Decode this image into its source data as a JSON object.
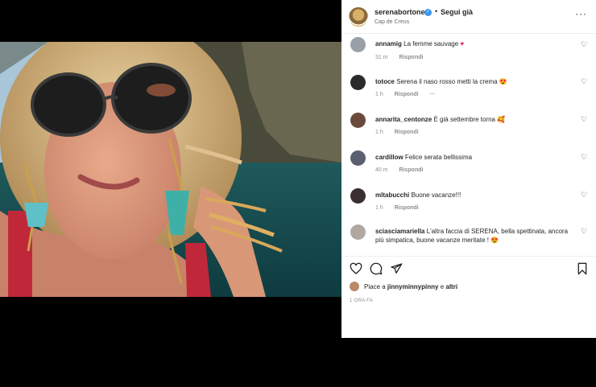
{
  "post": {
    "username": "serenabortone",
    "follow_label": "Segui già",
    "location": "Cap de Creus"
  },
  "comments": [
    {
      "user": "annamig",
      "text": "La femme sauvage",
      "emoji": "♥",
      "time": "31 m",
      "reply": "Rispondi"
    },
    {
      "user": "totoce",
      "text": "Serena il naso rosso metti la crema",
      "emoji": "😍",
      "time": "1 h",
      "reply": "Rispondi",
      "more": "···"
    },
    {
      "user": "annarita_centonze",
      "text": "È già settembre torna",
      "emoji": "🥰",
      "time": "1 h",
      "reply": "Rispondi"
    },
    {
      "user": "cardillow",
      "text": "Felice serata bellissima",
      "emoji": "",
      "time": "40 m",
      "reply": "Rispondi"
    },
    {
      "user": "mltabucchi",
      "text": "Buone vacanze!!!",
      "emoji": "",
      "time": "1 h",
      "reply": "Rispondi"
    },
    {
      "user": "sciasciamariella",
      "text": "L'altra faccia di SERENA, bella spettinata, ancora più simpatica, buone vacanze meritate !",
      "emoji": "😍",
      "time": "",
      "reply": ""
    }
  ],
  "likes": {
    "prefix": "Piace a ",
    "user": "jinnyminnypinny",
    "middle": " e ",
    "others": "altri"
  },
  "timestamp": "1 ORA FA",
  "icons": {
    "like": "heart-icon",
    "comment": "comment-icon",
    "share": "share-icon",
    "save": "bookmark-icon",
    "more": "more-icon"
  },
  "colors": {
    "verified": "#3897f0",
    "secondary_text": "#8e8e8e"
  }
}
